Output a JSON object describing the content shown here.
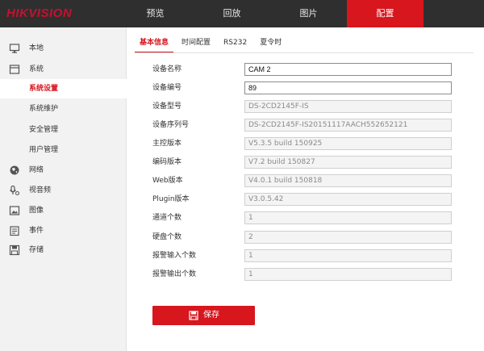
{
  "brand": "HIKVISION",
  "colors": {
    "accent": "#d7161e",
    "topbar": "#2f2f2f",
    "sidebar": "#f2f2f2"
  },
  "nav": [
    {
      "label": "预览"
    },
    {
      "label": "回放"
    },
    {
      "label": "图片"
    },
    {
      "label": "配置",
      "active": true
    }
  ],
  "sidebar": {
    "items": [
      {
        "label": "本地",
        "icon": "monitor-icon"
      },
      {
        "label": "系统",
        "icon": "system-icon"
      },
      {
        "label": "系统设置",
        "active": true
      },
      {
        "label": "系统维护"
      },
      {
        "label": "安全管理"
      },
      {
        "label": "用户管理"
      },
      {
        "label": "网络",
        "icon": "globe-icon"
      },
      {
        "label": "视音频",
        "icon": "audio-video-icon"
      },
      {
        "label": "图像",
        "icon": "image-icon"
      },
      {
        "label": "事件",
        "icon": "event-icon"
      },
      {
        "label": "存储",
        "icon": "storage-icon"
      }
    ]
  },
  "tabs": [
    {
      "label": "基本信息",
      "active": true
    },
    {
      "label": "时间配置"
    },
    {
      "label": "RS232"
    },
    {
      "label": "夏令时"
    }
  ],
  "form": {
    "fields": [
      {
        "label": "设备名称",
        "value": "CAM 2",
        "editable": true
      },
      {
        "label": "设备编号",
        "value": "89",
        "editable": true
      },
      {
        "label": "设备型号",
        "value": "DS-2CD2145F-IS"
      },
      {
        "label": "设备序列号",
        "value": "DS-2CD2145F-IS20151117AACH552652121"
      },
      {
        "label": "主控版本",
        "value": "V5.3.5 build 150925"
      },
      {
        "label": "编码版本",
        "value": "V7.2 build 150827"
      },
      {
        "label": "Web版本",
        "value": "V4.0.1 build 150818"
      },
      {
        "label": "Plugin版本",
        "value": "V3.0.5.42"
      },
      {
        "label": "通道个数",
        "value": "1"
      },
      {
        "label": "硬盘个数",
        "value": "2"
      },
      {
        "label": "报警输入个数",
        "value": "1"
      },
      {
        "label": "报警输出个数",
        "value": "1"
      }
    ]
  },
  "actions": {
    "save_label": "保存"
  }
}
